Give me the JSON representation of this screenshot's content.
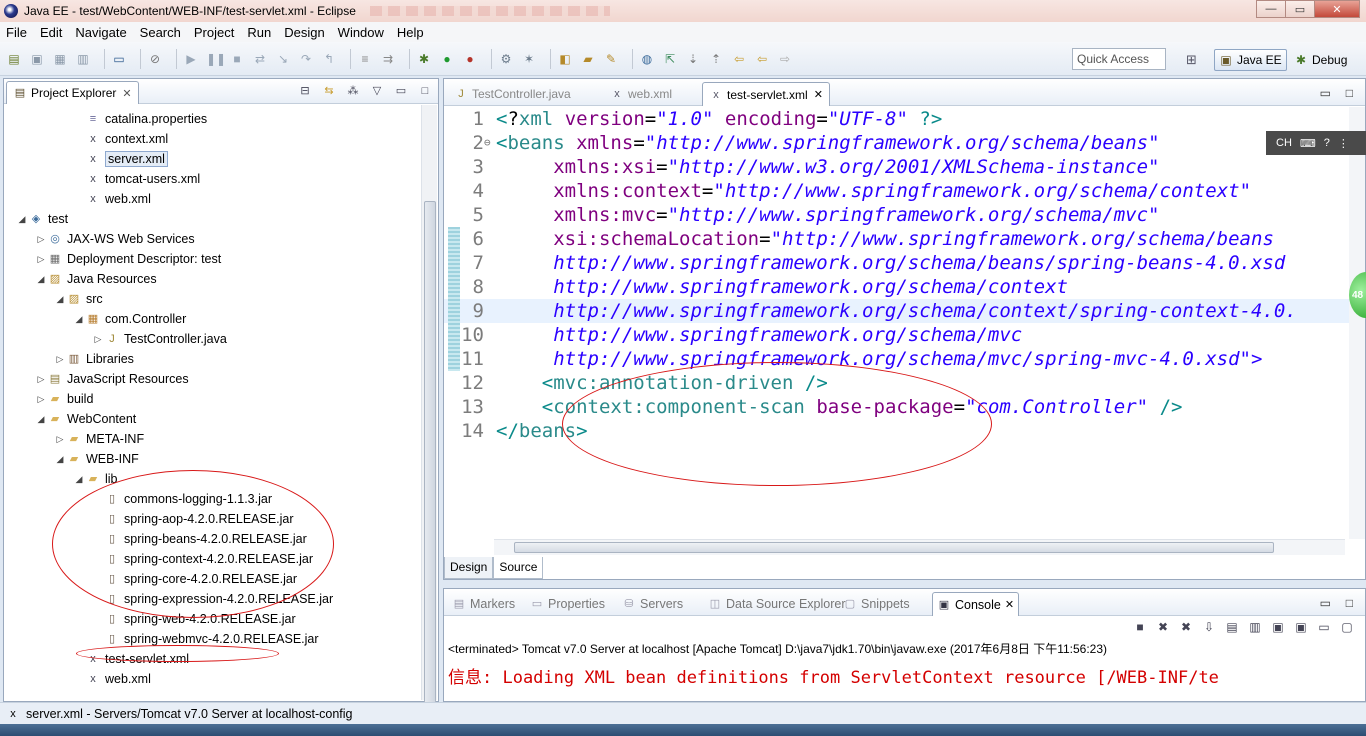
{
  "window": {
    "title": "Java EE - test/WebContent/WEB-INF/test-servlet.xml - Eclipse",
    "controls": {
      "minimize": "—",
      "maximize": "▭",
      "close": "✕"
    }
  },
  "menu": [
    "File",
    "Edit",
    "Navigate",
    "Search",
    "Project",
    "Run",
    "Design",
    "Window",
    "Help"
  ],
  "toolbar": {
    "quick_access": "Quick Access",
    "perspectives": [
      {
        "label": "Java EE",
        "icon": "javaee-perspective-icon",
        "active": true
      },
      {
        "label": "Debug",
        "icon": "debug-perspective-icon",
        "active": false
      }
    ]
  },
  "explorer": {
    "title": "Project Explorer",
    "close_glyph": "✕",
    "items": [
      {
        "label": "catalina.properties",
        "depth": 3,
        "icon": "properties-file-icon",
        "twisty": ""
      },
      {
        "label": "context.xml",
        "depth": 3,
        "icon": "xml-file-icon",
        "twisty": ""
      },
      {
        "label": "server.xml",
        "depth": 3,
        "icon": "xml-file-icon",
        "twisty": "",
        "selected": true
      },
      {
        "label": "tomcat-users.xml",
        "depth": 3,
        "icon": "xml-file-icon",
        "twisty": ""
      },
      {
        "label": "web.xml",
        "depth": 3,
        "icon": "xml-file-icon",
        "twisty": ""
      },
      {
        "label": "test",
        "depth": 0,
        "icon": "web-project-icon",
        "twisty": "◢"
      },
      {
        "label": "JAX-WS Web Services",
        "depth": 1,
        "icon": "webservices-icon",
        "twisty": "▷"
      },
      {
        "label": "Deployment Descriptor: test",
        "depth": 1,
        "icon": "deployment-descriptor-icon",
        "twisty": "▷"
      },
      {
        "label": "Java Resources",
        "depth": 1,
        "icon": "java-resources-icon",
        "twisty": "◢"
      },
      {
        "label": "src",
        "depth": 2,
        "icon": "source-folder-icon",
        "twisty": "◢"
      },
      {
        "label": "com.Controller",
        "depth": 3,
        "icon": "package-icon",
        "twisty": "◢"
      },
      {
        "label": "TestController.java",
        "depth": 4,
        "icon": "java-file-icon",
        "twisty": "▷"
      },
      {
        "label": "Libraries",
        "depth": 2,
        "icon": "libraries-icon",
        "twisty": "▷"
      },
      {
        "label": "JavaScript Resources",
        "depth": 1,
        "icon": "javascript-resources-icon",
        "twisty": "▷"
      },
      {
        "label": "build",
        "depth": 1,
        "icon": "folder-icon",
        "twisty": "▷"
      },
      {
        "label": "WebContent",
        "depth": 1,
        "icon": "folder-icon",
        "twisty": "◢"
      },
      {
        "label": "META-INF",
        "depth": 2,
        "icon": "folder-icon",
        "twisty": "▷"
      },
      {
        "label": "WEB-INF",
        "depth": 2,
        "icon": "folder-icon",
        "twisty": "◢"
      },
      {
        "label": "lib",
        "depth": 3,
        "icon": "folder-icon",
        "twisty": "◢"
      },
      {
        "label": "commons-logging-1.1.3.jar",
        "depth": 4,
        "icon": "jar-file-icon",
        "twisty": ""
      },
      {
        "label": "spring-aop-4.2.0.RELEASE.jar",
        "depth": 4,
        "icon": "jar-file-icon",
        "twisty": ""
      },
      {
        "label": "spring-beans-4.2.0.RELEASE.jar",
        "depth": 4,
        "icon": "jar-file-icon",
        "twisty": ""
      },
      {
        "label": "spring-context-4.2.0.RELEASE.jar",
        "depth": 4,
        "icon": "jar-file-icon",
        "twisty": ""
      },
      {
        "label": "spring-core-4.2.0.RELEASE.jar",
        "depth": 4,
        "icon": "jar-file-icon",
        "twisty": ""
      },
      {
        "label": "spring-expression-4.2.0.RELEASE.jar",
        "depth": 4,
        "icon": "jar-file-icon",
        "twisty": ""
      },
      {
        "label": "spring-web-4.2.0.RELEASE.jar",
        "depth": 4,
        "icon": "jar-file-icon",
        "twisty": ""
      },
      {
        "label": "spring-webmvc-4.2.0.RELEASE.jar",
        "depth": 4,
        "icon": "jar-file-icon",
        "twisty": ""
      },
      {
        "label": "test-servlet.xml",
        "depth": 3,
        "icon": "xml-file-icon",
        "twisty": ""
      },
      {
        "label": "web.xml",
        "depth": 3,
        "icon": "xml-file-icon",
        "twisty": ""
      }
    ]
  },
  "editor": {
    "tabs": [
      {
        "label": "TestController.java",
        "icon": "java-file-icon",
        "active": false
      },
      {
        "label": "web.xml",
        "icon": "xml-file-icon",
        "active": false
      },
      {
        "label": "test-servlet.xml",
        "icon": "xml-file-icon",
        "active": true
      }
    ],
    "close_glyph": "✕",
    "lines": [
      "<?xml version=\"1.0\" encoding=\"UTF-8\" ?>",
      "<beans xmlns=\"http://www.springframework.org/schema/beans\"",
      "     xmlns:xsi=\"http://www.w3.org/2001/XMLSchema-instance\"",
      "     xmlns:context=\"http://www.springframework.org/schema/context\"",
      "     xmlns:mvc=\"http://www.springframework.org/schema/mvc\"",
      "     xsi:schemaLocation=\"http://www.springframework.org/schema/beans",
      "     http://www.springframework.org/schema/beans/spring-beans-4.0.xsd",
      "     http://www.springframework.org/schema/context",
      "     http://www.springframework.org/schema/context/spring-context-4.0.",
      "     http://www.springframework.org/schema/mvc",
      "     http://www.springframework.org/schema/mvc/spring-mvc-4.0.xsd\">",
      "    <mvc:annotation-driven />",
      "    <context:component-scan base-package=\"com.Controller\" />",
      "</beans>"
    ],
    "highlighted_line": 9,
    "bottom_tabs": [
      {
        "label": "Design",
        "active": false
      },
      {
        "label": "Source",
        "active": true
      }
    ]
  },
  "ime": {
    "label": "CH"
  },
  "badge": {
    "label": "48"
  },
  "console": {
    "tabs": [
      {
        "label": "Markers",
        "icon": "markers-icon",
        "active": false
      },
      {
        "label": "Properties",
        "icon": "properties-icon",
        "active": false
      },
      {
        "label": "Servers",
        "icon": "servers-icon",
        "active": false
      },
      {
        "label": "Data Source Explorer",
        "icon": "data-source-icon",
        "active": false
      },
      {
        "label": "Snippets",
        "icon": "snippets-icon",
        "active": false
      },
      {
        "label": "Console",
        "icon": "console-icon",
        "active": true
      }
    ],
    "status": "<terminated> Tomcat v7.0 Server at localhost [Apache Tomcat] D:\\java7\\jdk1.70\\bin\\javaw.exe (2017年6月8日 下午11:56:23)",
    "output": "信息: Loading XML bean definitions from ServletContext resource [/WEB-INF/te"
  },
  "statusbar": {
    "text": "server.xml - Servers/Tomcat v7.0 Server at localhost-config"
  },
  "colors": {
    "annotation": "#d81818",
    "tag": "#2a8a8a",
    "attribute": "#7f007f",
    "string": "#2a00ff",
    "console_error": "#d40000"
  }
}
